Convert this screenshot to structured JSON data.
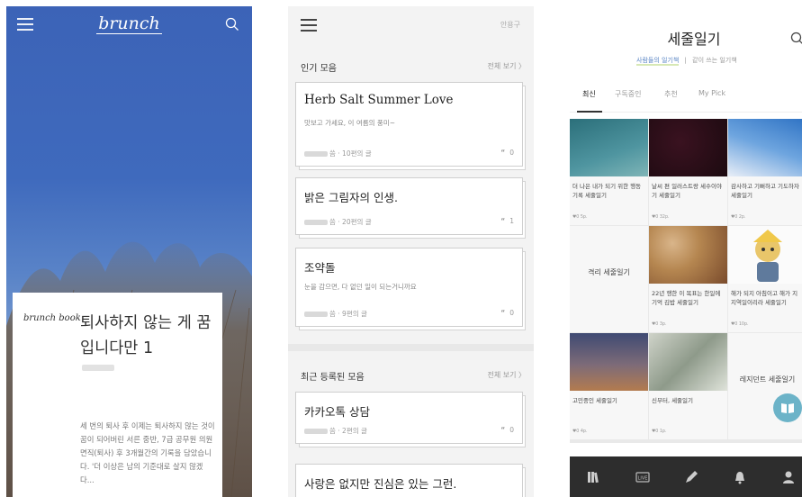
{
  "screen1": {
    "logo": "brunch",
    "book_badge": "brunch book",
    "title": "퇴사하지 않는 게 꿈입니다만 1",
    "description": "세 번의 퇴사 후 이제는 퇴사하지 않는 것이 꿈이 되어버린 서른 중반, 7급 공무원 의원면직(퇴사) 후 3개월간의 기록을 담았습니다. '더 이상은 남의 기준대로 살지 않겠다...",
    "icons": {
      "menu": "menu-icon",
      "search": "search-icon"
    },
    "colors": {
      "sky_top": "#3c63b7",
      "sky_bottom": "#a9bcd9"
    }
  },
  "screen2": {
    "user_label": "안용구",
    "popular": {
      "header": "인기 모음",
      "more": "전체 보기 〉"
    },
    "recent": {
      "header": "최근 등록된 모음",
      "more": "전체 보기 〉"
    },
    "books": [
      {
        "title": "Herb Salt Summer Love",
        "desc": "맛보고 가세요, 이 여름의 풍미~",
        "meta": "씀 · 10편의 글",
        "comments": "0"
      },
      {
        "title": "밝은 그림자의 인생.",
        "desc": "",
        "meta": "씀 · 20편의 글",
        "comments": "1"
      },
      {
        "title": "조약돌",
        "desc": "눈을 감으면, 다 없던 일이 되는거니까요",
        "meta": "씀 · 9편의 글",
        "comments": "0"
      },
      {
        "title": "카카오톡 상담",
        "desc": "",
        "meta": "씀 · 2편의 글",
        "comments": "0"
      },
      {
        "title": "사랑은 없지만 진심은 있는 그런.",
        "desc": "",
        "meta": "",
        "comments": ""
      }
    ],
    "quote_mark": "“"
  },
  "screen3": {
    "title": "세줄일기",
    "subnav": {
      "active": "사람들의 일기책",
      "separator": "|",
      "other": "같이 쓰는 일기책"
    },
    "tabs": [
      "최신",
      "구독중인",
      "추천",
      "My Pick"
    ],
    "cells": [
      {
        "caption": "더 나은 내가 되기 위한 행동기록 세줄일기",
        "meta": "♥0 5p."
      },
      {
        "caption": "날씨 편 일러스트랑 세수이야기 세줄일기",
        "meta": "♥0 32p."
      },
      {
        "caption": "감사하고 기뻐하고 기도하자 세줄일기",
        "meta": "♥0 2p."
      },
      {
        "caption": "격리 세줄일기",
        "meta": ""
      },
      {
        "caption": "22년 행한 이 목표는 한일에 기억 김밥 세줄일기",
        "meta": "♥0 3p."
      },
      {
        "caption": "해가 되지 아침이고 해가 지 지역일이리라 세줄일기",
        "meta": "♥0 10p."
      },
      {
        "caption": "고민중인 세줄일기",
        "meta": "♥0 4p."
      },
      {
        "caption": "신부터, 세줄일기",
        "meta": "♥0 1p."
      },
      {
        "caption": "레지던트 세줄일기",
        "meta": ""
      }
    ],
    "bottom_nav": [
      "library-icon",
      "live-icon",
      "pencil-icon",
      "bell-icon",
      "profile-icon"
    ],
    "colors": {
      "nav_bg": "#2d2d2d",
      "fab": "#6cb3c8"
    }
  }
}
